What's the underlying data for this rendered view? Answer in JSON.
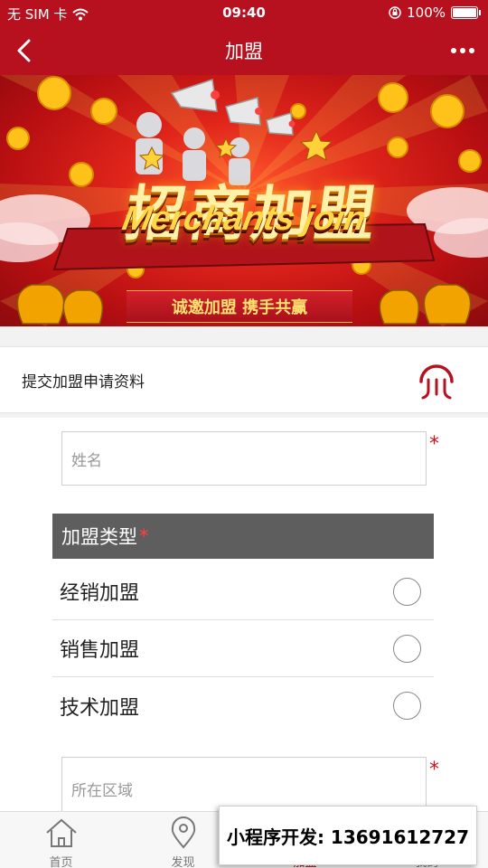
{
  "status": {
    "carrier": "无 SIM 卡",
    "time": "09:40",
    "battery": "100%"
  },
  "nav": {
    "title": "加盟"
  },
  "banner": {
    "title": "招商加盟",
    "subtitle": "Merchants join",
    "slogan": "诚邀加盟 携手共赢"
  },
  "section": {
    "label": "提交加盟申请资料"
  },
  "form": {
    "name_placeholder": "姓名",
    "required_mark": "*",
    "type_header": "加盟类型",
    "options": [
      {
        "label": "经销加盟",
        "selected": false
      },
      {
        "label": "销售加盟",
        "selected": false
      },
      {
        "label": "技术加盟",
        "selected": false
      }
    ],
    "region_placeholder": "所在区域"
  },
  "tabs": [
    {
      "label": "首页",
      "icon": "home-icon"
    },
    {
      "label": "发现",
      "icon": "location-pin-icon"
    },
    {
      "label": "加盟",
      "icon": "join-icon"
    },
    {
      "label": "我的",
      "icon": "user-icon"
    }
  ],
  "overlay": {
    "text": "小程序开发: 13691612727"
  },
  "colors": {
    "brand": "#b7111f",
    "type_header_bg": "#5e5e5e",
    "required": "#d0121b"
  }
}
